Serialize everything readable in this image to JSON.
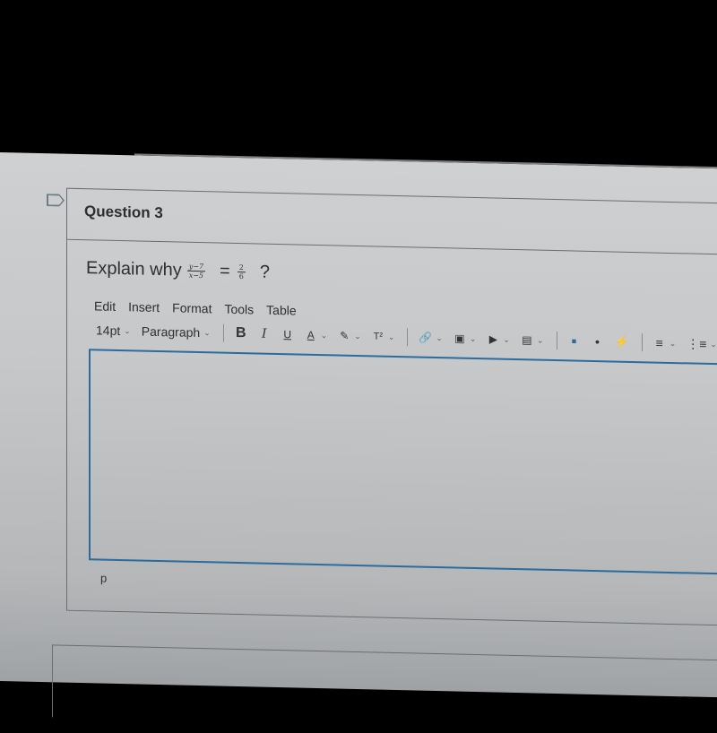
{
  "question": {
    "title": "Question 3",
    "prompt_prefix": "Explain why",
    "fraction_left": {
      "numerator": "y−7",
      "denominator": "x−5"
    },
    "equals": "=",
    "fraction_right": {
      "numerator": "2",
      "denominator": "6"
    },
    "prompt_suffix": "?"
  },
  "editor": {
    "menu": [
      "Edit",
      "Insert",
      "Format",
      "Tools",
      "Table"
    ],
    "font_size": "14pt",
    "block_format": "Paragraph",
    "buttons": {
      "bold": "B",
      "italic": "I",
      "underline": "U",
      "text_color": "A",
      "superscript": "T²"
    },
    "content": "",
    "path_label": "p"
  },
  "colors": {
    "editor_border": "#2b6c9f",
    "text": "#2d3033"
  }
}
